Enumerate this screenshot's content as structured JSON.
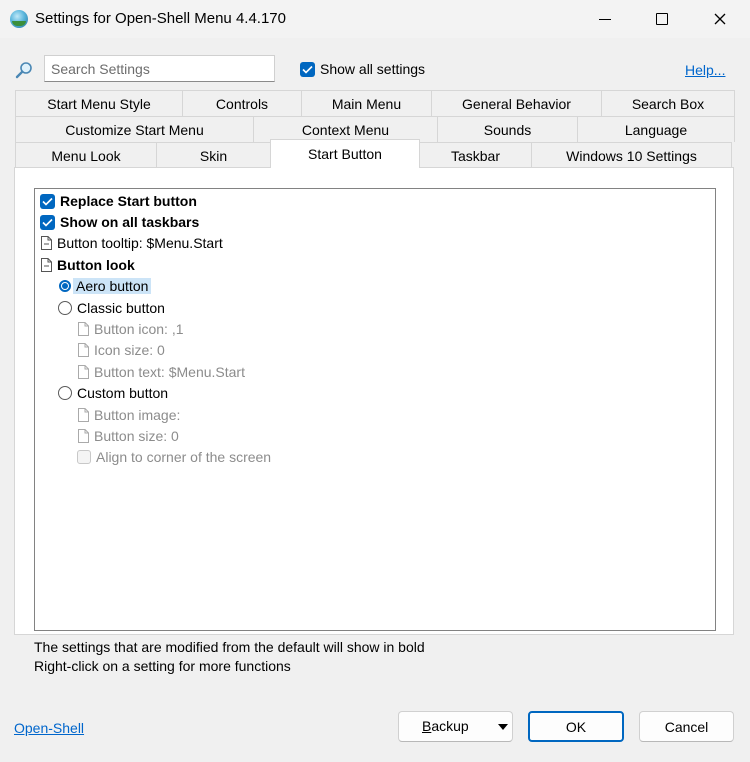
{
  "window": {
    "title": "Settings for Open-Shell Menu 4.4.170"
  },
  "search": {
    "placeholder": "Search Settings",
    "value": ""
  },
  "show_all": {
    "label": "Show all settings",
    "checked": true
  },
  "help_link": "Help...",
  "tabs": {
    "row1": [
      "Start Menu Style",
      "Controls",
      "Main Menu",
      "General Behavior",
      "Search Box"
    ],
    "row2": [
      "Customize Start Menu",
      "Context Menu",
      "Sounds",
      "Language"
    ],
    "row3": [
      "Menu Look",
      "Skin",
      "Start Button",
      "Taskbar",
      "Windows 10 Settings"
    ],
    "active": "Start Button"
  },
  "settings": {
    "replace_start": "Replace Start button",
    "show_all_taskbars": "Show on all taskbars",
    "button_tooltip": "Button tooltip: $Menu.Start",
    "button_look": "Button look",
    "aero_button": "Aero button",
    "classic_button": "Classic button",
    "button_icon": "Button icon: ,1",
    "icon_size": "Icon size: 0",
    "button_text": "Button text: $Menu.Start",
    "custom_button": "Custom button",
    "button_image": "Button image:",
    "button_size": "Button size: 0",
    "align_corner": "Align to corner of the screen"
  },
  "footer": {
    "line1": "The settings that are modified from the default will show in bold",
    "line2": "Right-click on a setting for more functions",
    "open_shell_link": "Open-Shell"
  },
  "buttons": {
    "backup_first": "B",
    "backup_rest": "ackup",
    "ok": "OK",
    "cancel": "Cancel"
  },
  "colors": {
    "accent": "#0067c0",
    "link": "#0066cc",
    "selection": "#cce4f7"
  }
}
